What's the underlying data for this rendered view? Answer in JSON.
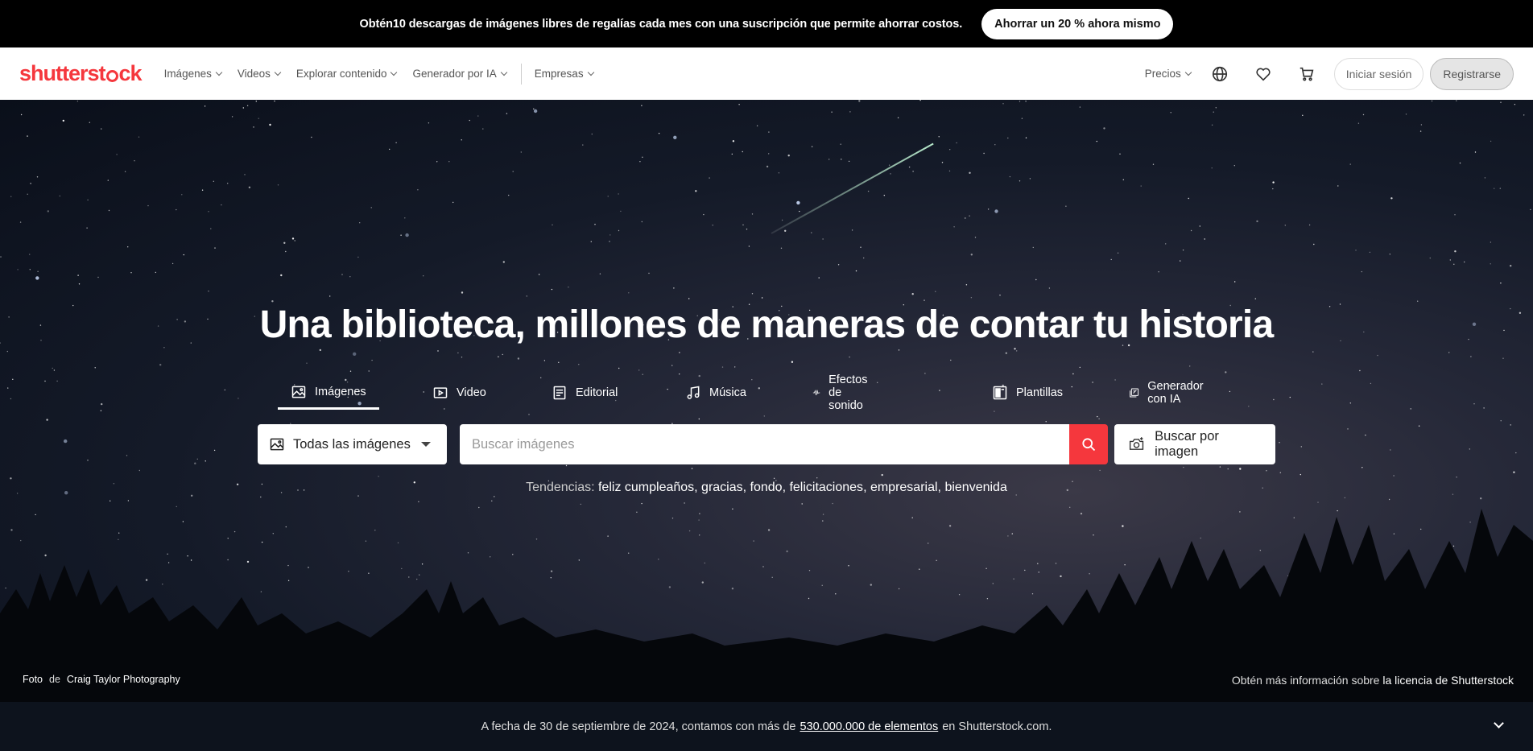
{
  "promo": {
    "text": "Obtén10 descargas de imágenes libres de regalías cada mes con una suscripción que permite ahorrar costos.",
    "button": "Ahorrar un 20 % ahora mismo"
  },
  "header": {
    "logo_left": "shutterst",
    "logo_right": "ck",
    "nav": [
      "Imágenes",
      "Videos",
      "Explorar contenido",
      "Generador por IA",
      "Empresas"
    ],
    "pricing": "Precios",
    "login": "Iniciar sesión",
    "register": "Registrarse",
    "icons": [
      "globe-icon",
      "heart-icon",
      "cart-icon"
    ]
  },
  "hero": {
    "title": "Una biblioteca, millones de maneras de contar tu historia",
    "tabs": [
      {
        "label": "Imágenes",
        "icon": "image-icon",
        "active": true
      },
      {
        "label": "Video",
        "icon": "video-icon"
      },
      {
        "label": "Editorial",
        "icon": "editorial-icon"
      },
      {
        "label": "Música",
        "icon": "music-icon"
      },
      {
        "label": "Efectos de sonido",
        "icon": "sound-wave-icon"
      },
      {
        "label": "Plantillas",
        "icon": "templates-icon"
      },
      {
        "label": "Generador con IA",
        "icon": "ai-generator-icon"
      }
    ],
    "type_select": "Todas las imágenes",
    "search_placeholder": "Buscar imágenes",
    "image_search": "Buscar por imagen",
    "trending_label": "Tendencias:",
    "trending": [
      "feliz cumpleaños",
      "gracias",
      "fondo",
      "felicitaciones",
      "empresarial",
      "bienvenida"
    ],
    "credit_prefix": "Foto",
    "credit_de": "de",
    "credit_author": "Craig Taylor Photography",
    "license_prefix": "Obtén más información sobre",
    "license_link": "la licencia de Shutterstock"
  },
  "infobar": {
    "before": "A fecha de 30 de septiembre de 2024, contamos con más de",
    "link": "530.000.000 de elementos",
    "after": "en Shutterstock.com."
  },
  "colors": {
    "brand": "#f5373d",
    "promo_bg": "#000000",
    "infobar_bg": "#0d131d"
  }
}
